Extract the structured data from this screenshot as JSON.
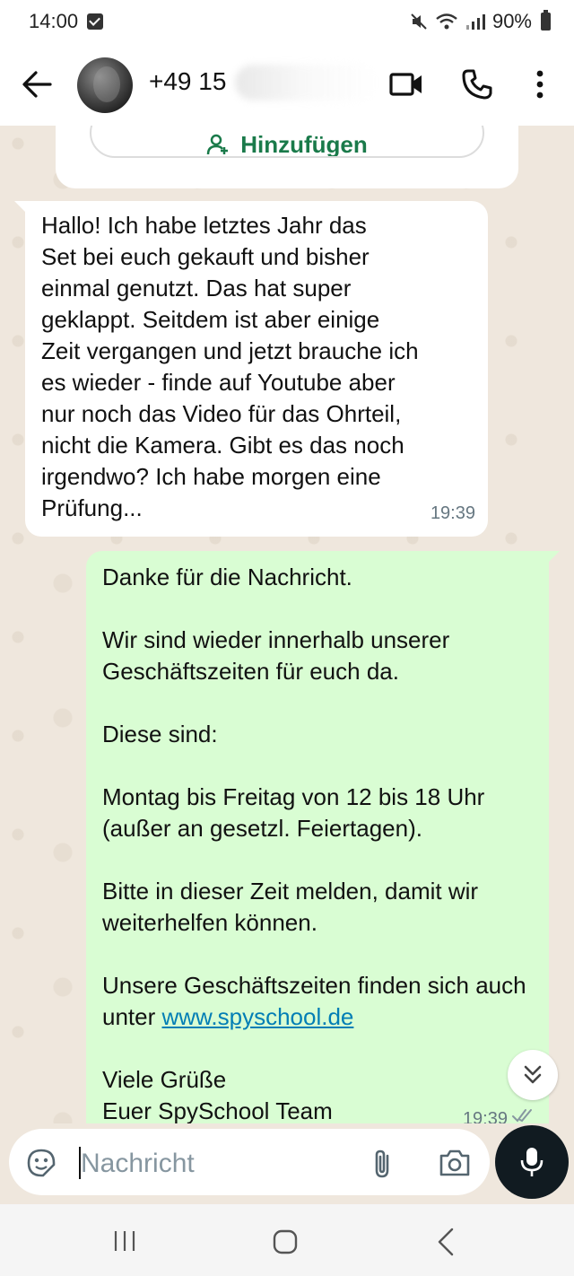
{
  "status_bar": {
    "time": "14:00",
    "battery": "90%"
  },
  "header": {
    "contact_name": "+49 15"
  },
  "system_card": {
    "add_label": "Hinzufügen"
  },
  "messages": {
    "incoming": {
      "text": "Hallo! Ich habe letztes Jahr das\nSet bei euch gekauft und bisher\neinmal genutzt. Das hat super\ngeklappt. Seitdem ist aber einige\nZeit vergangen und jetzt brauche ich\nes wieder - finde auf Youtube aber\nnur noch das Video für das Ohrteil,\nnicht die Kamera. Gibt es das noch\nirgendwo? Ich habe morgen eine\nPrüfung...",
      "time": "19:39"
    },
    "outgoing": {
      "p1": "Danke für die Nachricht.",
      "p2": "Wir sind wieder innerhalb unserer Geschäftszeiten für euch da.",
      "p3": "Diese sind:",
      "p4": "Montag bis Freitag von 12 bis 18 Uhr (außer an gesetzl. Feiertagen).",
      "p5": "Bitte in dieser Zeit melden, damit wir weiterhelfen können.",
      "p6_text": "Unsere Geschäftszeiten finden sich auch unter ",
      "p6_link": "www.spyschool.de",
      "p7_line1": "Viele Grüße",
      "p7_line2": "Euer SpySchool Team",
      "time": "19:39"
    }
  },
  "input": {
    "placeholder": "Nachricht"
  },
  "colors": {
    "incoming_bubble": "#ffffff",
    "outgoing_bubble": "#d9fdd3",
    "link": "#027eb5",
    "add_button_text": "#1a7a4a",
    "mic_button": "#111b21"
  },
  "icons": {
    "header": [
      "back-arrow-icon",
      "video-call-icon",
      "phone-icon",
      "more-vertical-icon"
    ],
    "input": [
      "sticker-icon",
      "attach-icon",
      "camera-icon",
      "mic-icon"
    ],
    "nav": [
      "recents-icon",
      "home-icon",
      "back-icon"
    ]
  }
}
